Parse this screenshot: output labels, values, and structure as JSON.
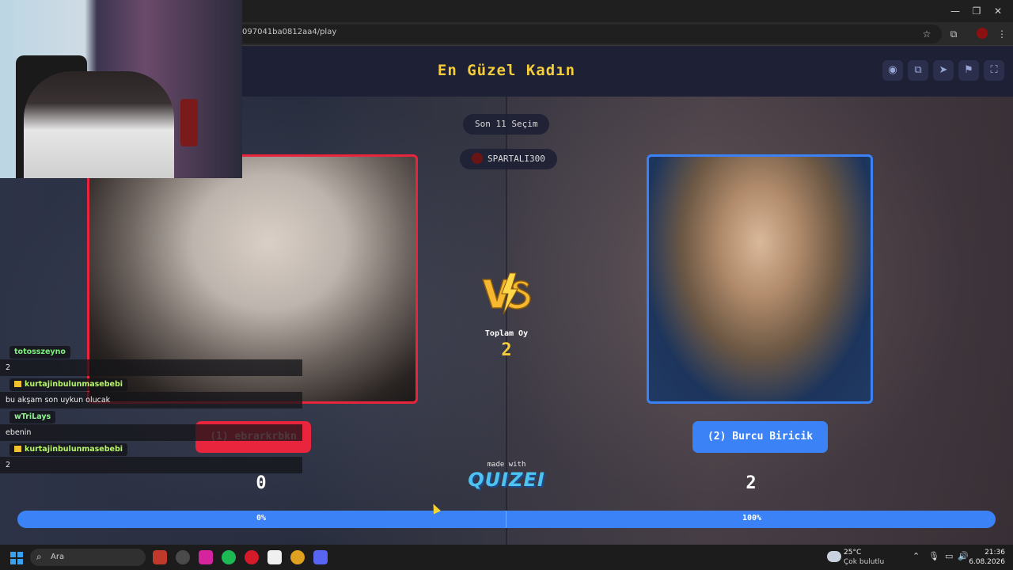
{
  "browser": {
    "url": "097041ba0812aa4/play",
    "window_controls": {
      "minimize": "—",
      "restore": "❐",
      "close": "✕"
    },
    "icons": {
      "bookmark": "☆",
      "extensions": "⧉",
      "menu": "⋮"
    }
  },
  "quiz": {
    "title": "En Güzel Kadın",
    "header_icons": [
      "eye-icon",
      "copy-icon",
      "send-icon",
      "flag-icon",
      "fullscreen-icon"
    ],
    "header_glyphs": [
      "◉",
      "⧉",
      "➤",
      "⚑",
      "⛶"
    ],
    "round_label": "Son 11 Seçim",
    "player_name": "SPARTALI300",
    "total_votes_label": "Toplam Oy",
    "total_votes": "2",
    "left": {
      "label": "(1) ebrarkrbkn",
      "score": "0",
      "percent": "0%",
      "color": "#e8253d"
    },
    "right": {
      "label": "(2) Burcu Biricik",
      "score": "2",
      "percent": "100%",
      "color": "#3b82f6"
    },
    "made_with": "made with",
    "brand": "QUIZEI",
    "progress_fraction_right": 1.0
  },
  "chat": [
    {
      "user": "totosszeyno",
      "user_color": "#7cf07c",
      "badge": false,
      "message": "2"
    },
    {
      "user": "kurtajinbulunmasebebi",
      "user_color": "#b8f56a",
      "badge": true,
      "message": "bu akşam son uykun olucak"
    },
    {
      "user": "wTriLays",
      "user_color": "#8ff58f",
      "badge": false,
      "message": "ebenin"
    },
    {
      "user": "kurtajinbulunmasebebi",
      "user_color": "#b8f56a",
      "badge": true,
      "message": "2"
    }
  ],
  "taskbar": {
    "search_placeholder": "Ara",
    "weather_temp": "25°C",
    "weather_desc": "Çok bulutlu",
    "time": "21:36",
    "date": "6.08.2026",
    "tray_glyphs": {
      "chevron": "⌃",
      "mic": "🎙",
      "display": "▭",
      "volume": "🔊"
    }
  }
}
